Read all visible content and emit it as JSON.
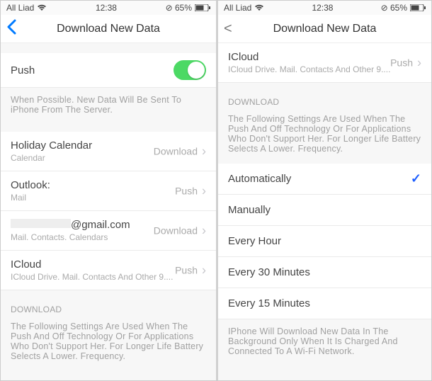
{
  "left": {
    "status": {
      "carrier": "All Liad",
      "time": "12:38",
      "battery": "65%"
    },
    "nav_title": "Download New Data",
    "push_row": {
      "label": "Push"
    },
    "push_footer": "When Possible. New Data Will Be Sent To iPhone From The Server.",
    "accounts": [
      {
        "title": "Holiday Calendar",
        "sub": "Calendar",
        "method": "Download"
      },
      {
        "title": "Outlook:",
        "sub": "Mail",
        "method": "Push"
      },
      {
        "title_suffix": "@gmail.com",
        "sub": "Mail. Contacts. Calendars",
        "method": "Download"
      },
      {
        "title": "ICloud",
        "sub": "ICloud Drive. Mail. Contacts And Other 9....",
        "method": "Push"
      }
    ],
    "download_header": "DOWNLOAD",
    "download_text": "The Following Settings Are Used When The Push And Off Technology Or For Applications Who Don't Support Her. For Longer Life Battery Selects A Lower. Frequency."
  },
  "right": {
    "status": {
      "carrier": "All Liad",
      "time": "12:38",
      "battery": "65%"
    },
    "nav_title": "Download New Data",
    "icloud_row": {
      "title": "ICloud",
      "sub": "ICloud Drive. Mail. Contacts And Other 9....",
      "method": "Push"
    },
    "download_header": "DOWNLOAD",
    "download_text": "The Following Settings Are Used When The Push And Off Technology Or For Applications Who Don't Support Her. For Longer Life Battery Selects A Lower. Frequency.",
    "options": [
      {
        "label": "Automatically",
        "selected": true
      },
      {
        "label": "Manually",
        "selected": false
      },
      {
        "label": "Every Hour",
        "selected": false
      },
      {
        "label": "Every 30 Minutes",
        "selected": false
      },
      {
        "label": "Every 15 Minutes",
        "selected": false
      }
    ],
    "footer": "IPhone Will Download New Data In The Background Only When It Is Charged And Connected To A Wi-Fi Network."
  }
}
